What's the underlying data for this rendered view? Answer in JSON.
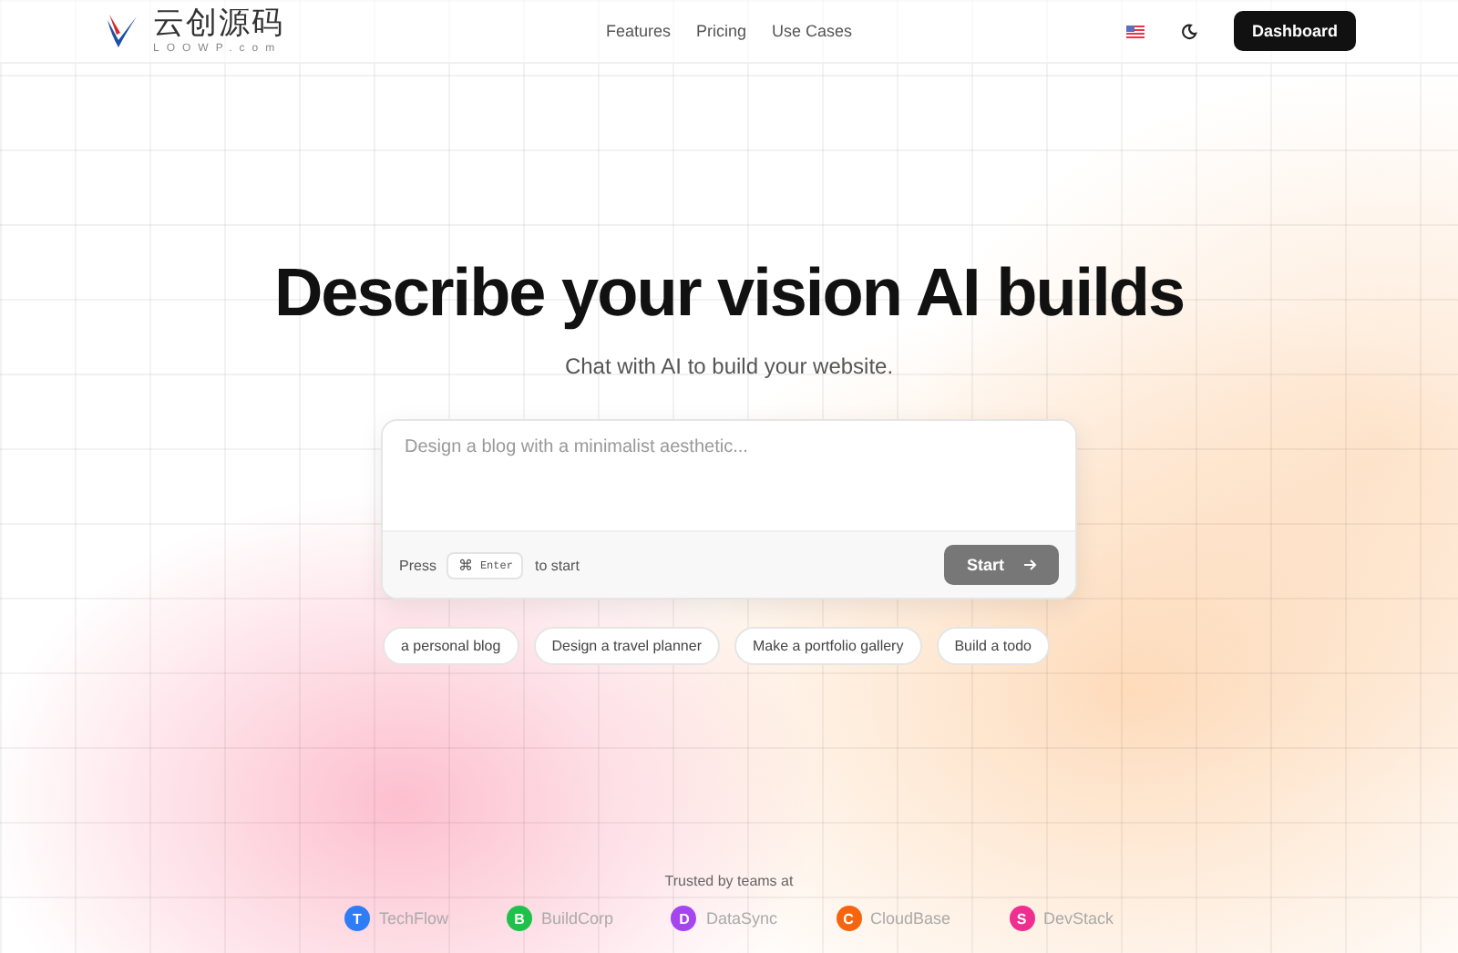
{
  "header": {
    "logo": {
      "name": "云创源码",
      "domain": "LOOWP.com"
    },
    "nav": [
      "Features",
      "Pricing",
      "Use Cases"
    ],
    "dashboard_button": "Dashboard"
  },
  "hero": {
    "title": "Describe your vision AI builds",
    "subtitle": "Chat with AI to build your website."
  },
  "prompt": {
    "placeholder": "Design a blog with a minimalist aesthetic...",
    "hint_before": "Press",
    "key_symbol": "⌘",
    "key_label": "Enter",
    "hint_after": "to start",
    "start_button": "Start"
  },
  "suggestions": [
    "a personal blog",
    "Design a travel planner",
    "Make a portfolio gallery",
    "Build a todo"
  ],
  "trusted": {
    "label": "Trusted by teams at",
    "companies": [
      {
        "initial": "T",
        "name": "TechFlow",
        "color": "#2f7df6"
      },
      {
        "initial": "B",
        "name": "BuildCorp",
        "color": "#1ec24a"
      },
      {
        "initial": "D",
        "name": "DataSync",
        "color": "#a445f0"
      },
      {
        "initial": "C",
        "name": "CloudBase",
        "color": "#f5650f"
      },
      {
        "initial": "S",
        "name": "DevStack",
        "color": "#ee2f8f"
      }
    ]
  }
}
